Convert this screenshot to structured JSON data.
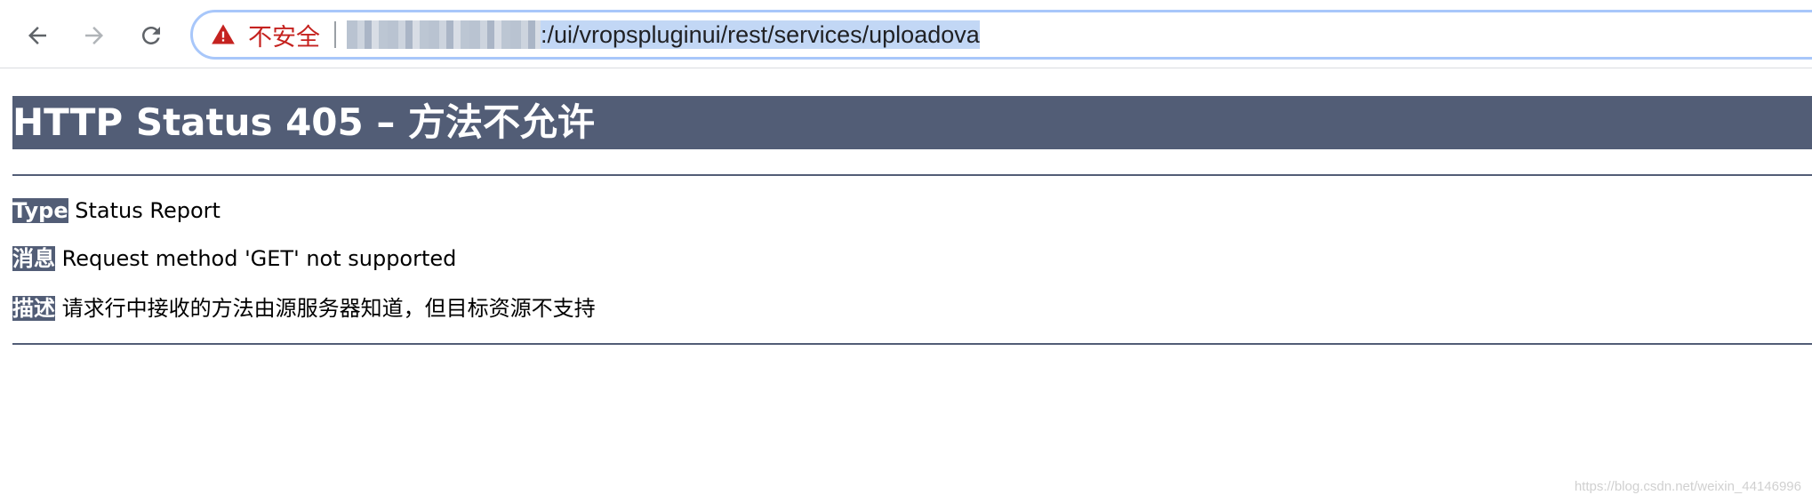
{
  "browser": {
    "security_label": "不安全",
    "url_host": "▒▒▒▒▒▒▒▒▒▒▒▒▒",
    "url_path": ":/ui/vropspluginui/rest/services/uploadova",
    "icons": {
      "back": "arrow-left-icon",
      "forward": "arrow-right-icon",
      "reload": "reload-icon",
      "warning": "warning-triangle-icon"
    },
    "colors": {
      "warning": "#c5221f",
      "selection": "#c2d7f5",
      "focus_ring": "#a8c7fa"
    }
  },
  "page": {
    "title": "HTTP Status 405 – 方法不允许",
    "type_label": "Type",
    "type_value": "Status Report",
    "message_label": "消息",
    "message_value": "Request method 'GET' not supported",
    "description_label": "描述",
    "description_value": "请求行中接收的方法由源服务器知道，但目标资源不支持",
    "colors": {
      "header_bg": "#525d76",
      "header_text": "#ffffff"
    }
  },
  "watermark": "https://blog.csdn.net/weixin_44146996"
}
